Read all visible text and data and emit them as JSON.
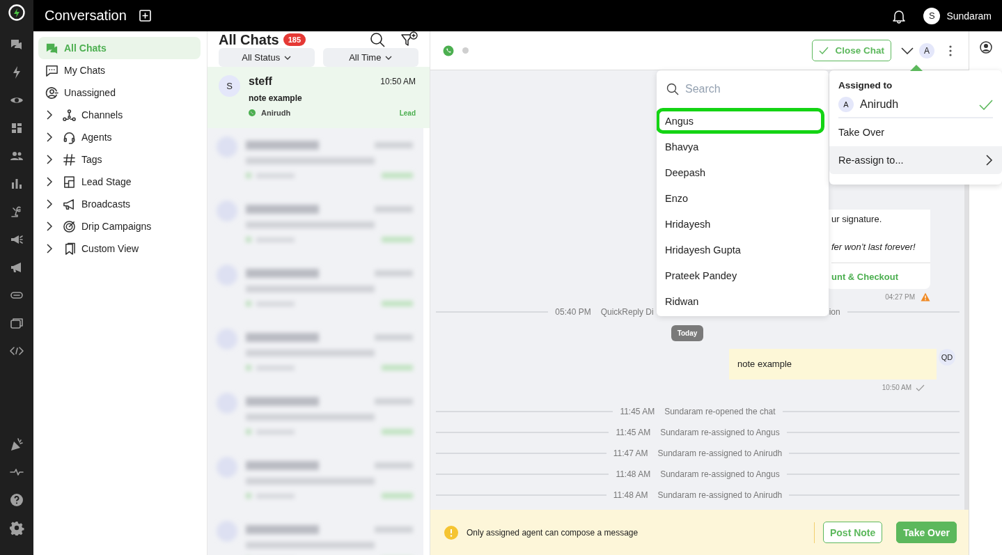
{
  "app": {
    "title": "Conversation"
  },
  "header": {
    "user_initial": "S",
    "user_name": "Sundaram"
  },
  "nav": {
    "items": [
      {
        "label": "All Chats",
        "selected": true,
        "expandable": false
      },
      {
        "label": "My Chats",
        "selected": false,
        "expandable": false
      },
      {
        "label": "Unassigned",
        "selected": false,
        "expandable": false
      },
      {
        "label": "Channels",
        "selected": false,
        "expandable": true
      },
      {
        "label": "Agents",
        "selected": false,
        "expandable": true
      },
      {
        "label": "Tags",
        "selected": false,
        "expandable": true
      },
      {
        "label": "Lead Stage",
        "selected": false,
        "expandable": true
      },
      {
        "label": "Broadcasts",
        "selected": false,
        "expandable": true
      },
      {
        "label": "Drip Campaigns",
        "selected": false,
        "expandable": true
      },
      {
        "label": "Custom View",
        "selected": false,
        "expandable": true
      }
    ]
  },
  "chat_list": {
    "title": "All Chats",
    "count": "185",
    "filters": [
      "All Status",
      "All Time"
    ],
    "chats": [
      {
        "kind": "chat",
        "initial": "S",
        "name": "steff",
        "time": "10:50 AM",
        "preview": "note example",
        "agent": "Anirudh",
        "stage": "Lead",
        "selected": true
      },
      {
        "kind": "blurred"
      },
      {
        "kind": "blurred"
      },
      {
        "kind": "blurred"
      },
      {
        "kind": "blurred"
      },
      {
        "kind": "blurred"
      },
      {
        "kind": "blurred"
      },
      {
        "kind": "blurred"
      }
    ]
  },
  "chat": {
    "close_label": "Close Chat",
    "assignee_initial": "A",
    "messages": [
      {
        "kind": "bubble",
        "lines": [
          "ur signature.",
          "fer won’t last forever!"
        ],
        "link": "unt & Checkout",
        "time": "04:27 PM",
        "warning": true
      },
      {
        "kind": "system_cut",
        "time": "05:40 PM",
        "text_start": "QuickReply Di",
        "text_end": "ion"
      },
      {
        "kind": "day",
        "label": "Today"
      },
      {
        "kind": "note",
        "text": "note example",
        "sender": "QD",
        "time": "10:50 AM",
        "sent": true
      },
      {
        "kind": "system",
        "time": "11:45 AM",
        "text": "Sundaram re-opened the chat"
      },
      {
        "kind": "system",
        "time": "11:45 AM",
        "text": "Sundaram re-assigned to Angus"
      },
      {
        "kind": "system",
        "time": "11:47 AM",
        "text": "Sundaram re-assigned to Anirudh"
      },
      {
        "kind": "system",
        "time": "11:48 AM",
        "text": "Sundaram re-assigned to Angus"
      },
      {
        "kind": "system",
        "time": "11:48 AM",
        "text": "Sundaram re-assigned to Anirudh"
      }
    ],
    "footer": {
      "notice": "Only assigned agent can compose a message",
      "buttons": [
        "Post Note",
        "Take Over"
      ]
    }
  },
  "agent_menu": {
    "placeholder": "Search",
    "agents": [
      {
        "name": "Angus",
        "highlighted": true
      },
      {
        "name": "Bhavya",
        "highlighted": false
      },
      {
        "name": "Deepash",
        "highlighted": false
      },
      {
        "name": "Enzo",
        "highlighted": false
      },
      {
        "name": "Hridayesh",
        "highlighted": false
      },
      {
        "name": "Hridayesh Gupta",
        "highlighted": false
      },
      {
        "name": "Prateek Pandey",
        "highlighted": false
      },
      {
        "name": "Ridwan",
        "highlighted": false
      }
    ]
  },
  "assign_menu": {
    "heading": "Assigned to",
    "assignee": {
      "initial": "A",
      "name": "Anirudh",
      "checked": true
    },
    "options": [
      {
        "label": "Take Over",
        "hovered": false,
        "submenu": false
      },
      {
        "label": "Re-assign to...",
        "hovered": true,
        "submenu": true
      }
    ]
  }
}
